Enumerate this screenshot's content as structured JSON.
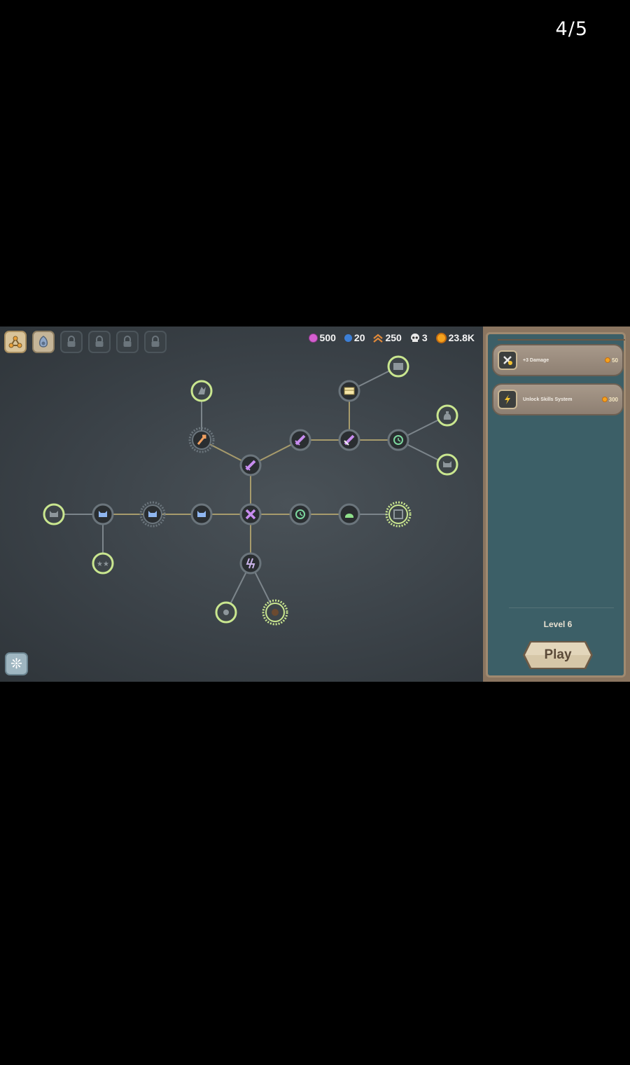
{
  "page_counter": "4/5",
  "tabs": [
    {
      "name": "skill-tree-icon",
      "locked": false
    },
    {
      "name": "egg-icon",
      "locked": false
    },
    {
      "name": "lock-icon",
      "locked": true
    },
    {
      "name": "lock-icon",
      "locked": true
    },
    {
      "name": "lock-icon",
      "locked": true
    },
    {
      "name": "lock-icon",
      "locked": true
    }
  ],
  "resources": {
    "gems": "500",
    "orbs": "20",
    "rank": "250",
    "skulls": "3",
    "coins": "23.8K"
  },
  "colors": {
    "gems": "#d45fd0",
    "orbs": "#3c7fd6",
    "rank": "#e0893a",
    "skulls": "#e9e9e9",
    "coins": "#f4a21e",
    "node_ring_active": "#c9e68f",
    "node_ring_purchased": "#6b757c",
    "edge_active": "#a79b6c",
    "edge_locked": "#7c858b"
  },
  "upgrades": [
    {
      "icon": "damage-icon",
      "name": "+3 Damage",
      "cost": "50"
    },
    {
      "icon": "lightning-icon",
      "name": "Unlock Skills System",
      "cost": "300"
    }
  ],
  "level_label": "Level 6",
  "play_label": "Play",
  "settings_icon": "settings-icon"
}
